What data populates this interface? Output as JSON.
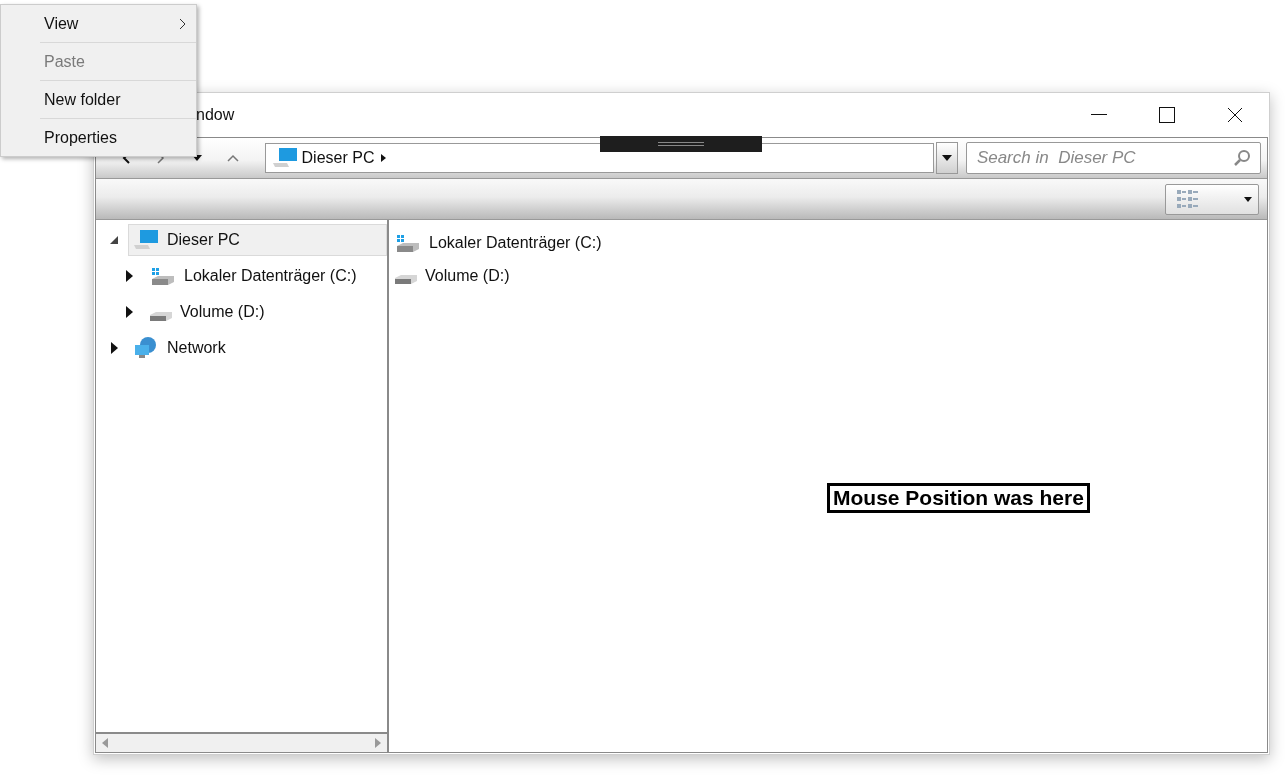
{
  "window": {
    "title": "ndow"
  },
  "navigation": {
    "address": "Dieser PC",
    "search": {
      "placeholder": "Search in  Dieser PC"
    }
  },
  "tree": [
    {
      "label": "Dieser PC",
      "kind": "pc",
      "expanded": true,
      "selected": true,
      "children": [
        {
          "label": "Lokaler Datenträger (C:)",
          "kind": "system-drive",
          "expanded": false,
          "selected": false
        },
        {
          "label": "Volume (D:)",
          "kind": "drive",
          "expanded": false,
          "selected": false
        }
      ]
    },
    {
      "label": "Network",
      "kind": "network",
      "expanded": false,
      "selected": false
    }
  ],
  "files": [
    {
      "label": "Lokaler Datenträger (C:)",
      "kind": "system-drive"
    },
    {
      "label": "Volume (D:)",
      "kind": "drive"
    }
  ],
  "mouse_marker": "Mouse Position was here",
  "context_menu": [
    {
      "label": "View",
      "disabled": false,
      "submenu": true
    },
    {
      "label": "Paste",
      "disabled": true,
      "submenu": false
    },
    {
      "label": "New folder",
      "disabled": false,
      "submenu": false
    },
    {
      "label": "Properties",
      "disabled": false,
      "submenu": false
    }
  ]
}
